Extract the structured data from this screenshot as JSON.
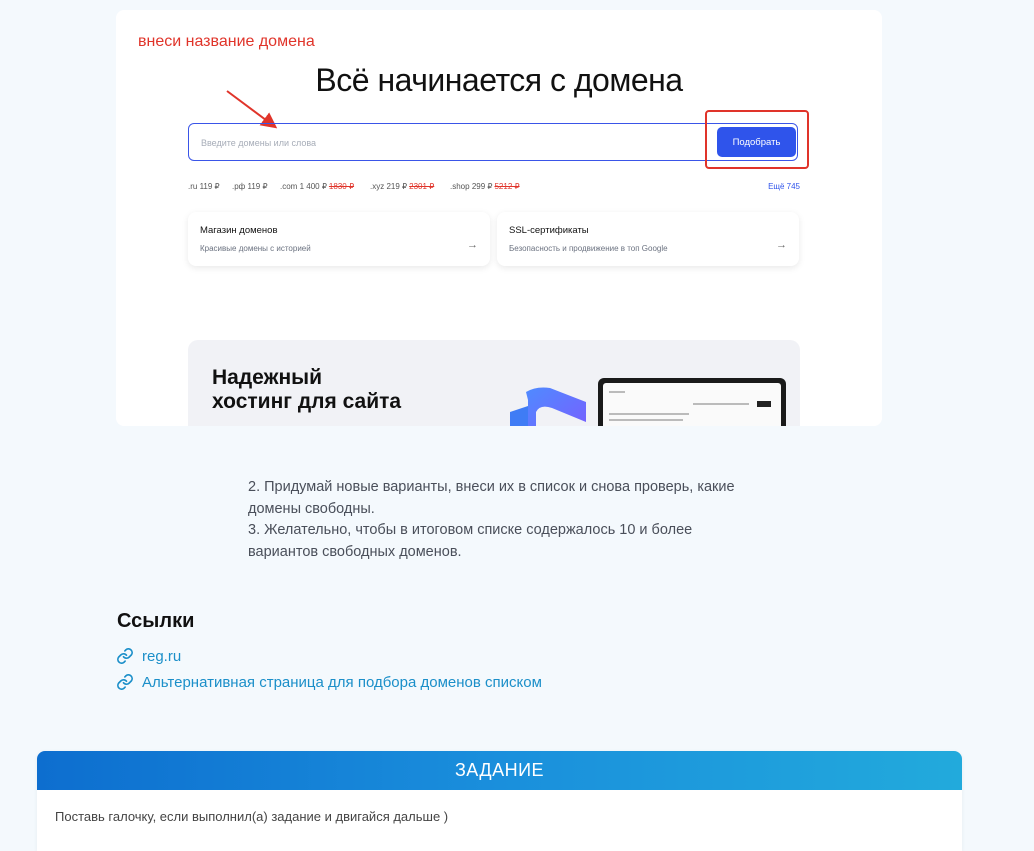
{
  "screenshot": {
    "hint": "внеси название домена",
    "title": "Всё начинается с домена",
    "search_placeholder": "Введите домены или слова",
    "search_button": "Подобрать",
    "zones": [
      {
        "name": ".ru",
        "price": "119 ₽",
        "old_price": ""
      },
      {
        "name": ".рф",
        "price": "119 ₽",
        "old_price": ""
      },
      {
        "name": ".com",
        "price": "1 400 ₽",
        "old_price": "1830 ₽"
      },
      {
        "name": ".xyz",
        "price": "219 ₽",
        "old_price": "2301 ₽"
      },
      {
        "name": ".shop",
        "price": "299 ₽",
        "old_price": "5212 ₽"
      }
    ],
    "more_link": "Ещё 745",
    "cards": [
      {
        "title": "Магазин доменов",
        "subtitle": "Красивые домены с историей",
        "arrow": "→"
      },
      {
        "title": "SSL-сертификаты",
        "subtitle": "Безопасность и продвижение в топ Google",
        "arrow": "→"
      }
    ],
    "promo_title_line1": "Надежный",
    "promo_title_line2": "хостинг для сайта"
  },
  "steps": [
    "2. Придумай новые варианты, внеси их в список и снова проверь, какие домены свободны.",
    "3. Желательно, чтобы в итоговом списке содержалось 10 и более вариантов свободных доменов."
  ],
  "links": {
    "title": "Ссылки",
    "items": [
      {
        "label": "reg.ru",
        "icon": "link-icon"
      },
      {
        "label": "Альтернативная страница для подбора доменов списком",
        "icon": "link-icon"
      }
    ]
  },
  "task": {
    "header": "ЗАДАНИЕ",
    "text": "Поставь галочку, если выполнил(а) задание и двигайся дальше )"
  },
  "colors": {
    "accent_blue": "#2f54eb",
    "annotation_red": "#e0342a",
    "link": "#1b8fc9",
    "task_header": "#1a8fdc"
  }
}
